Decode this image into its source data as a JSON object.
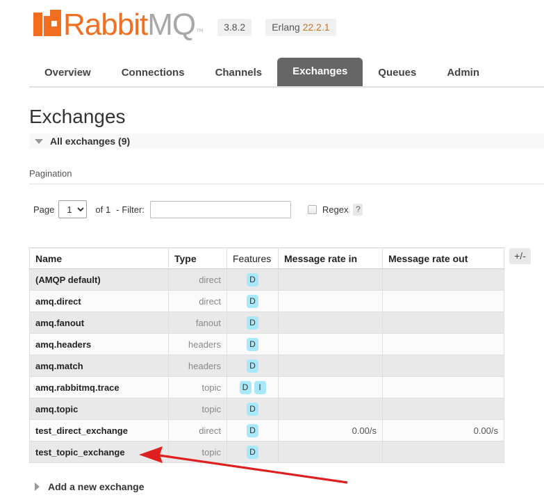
{
  "header": {
    "brand_rabbit": "Rabbit",
    "brand_mq": "MQ",
    "trademark": "™",
    "version": "3.8.2",
    "erlang_label": "Erlang",
    "erlang_version": "22.2.1",
    "brand_color": "#f26f21",
    "mq_color": "#a8a8a8"
  },
  "nav": {
    "tabs": [
      {
        "label": "Overview",
        "active": false
      },
      {
        "label": "Connections",
        "active": false
      },
      {
        "label": "Channels",
        "active": false
      },
      {
        "label": "Exchanges",
        "active": true
      },
      {
        "label": "Queues",
        "active": false
      },
      {
        "label": "Admin",
        "active": false
      }
    ],
    "active_tab_bg": "#666666"
  },
  "page": {
    "title": "Exchanges",
    "section_label": "All exchanges (9)",
    "section_expanded": true
  },
  "pagination": {
    "title": "Pagination",
    "page_label": "Page",
    "page_value": "1",
    "page_options": [
      "1"
    ],
    "of_label": "of 1",
    "dash": "-",
    "filter_label": "Filter:",
    "filter_value": "",
    "filter_placeholder": "",
    "regex_label": "Regex",
    "regex_checked": false,
    "help_label": "?"
  },
  "table": {
    "columns": [
      "Name",
      "Type",
      "Features",
      "Message rate in",
      "Message rate out"
    ],
    "column_toggle_label": "+/-",
    "rows": [
      {
        "name": "(AMQP default)",
        "type": "direct",
        "features": [
          "D"
        ],
        "rate_in": "",
        "rate_out": ""
      },
      {
        "name": "amq.direct",
        "type": "direct",
        "features": [
          "D"
        ],
        "rate_in": "",
        "rate_out": ""
      },
      {
        "name": "amq.fanout",
        "type": "fanout",
        "features": [
          "D"
        ],
        "rate_in": "",
        "rate_out": ""
      },
      {
        "name": "amq.headers",
        "type": "headers",
        "features": [
          "D"
        ],
        "rate_in": "",
        "rate_out": ""
      },
      {
        "name": "amq.match",
        "type": "headers",
        "features": [
          "D"
        ],
        "rate_in": "",
        "rate_out": ""
      },
      {
        "name": "amq.rabbitmq.trace",
        "type": "topic",
        "features": [
          "D",
          "I"
        ],
        "rate_in": "",
        "rate_out": ""
      },
      {
        "name": "amq.topic",
        "type": "topic",
        "features": [
          "D"
        ],
        "rate_in": "",
        "rate_out": ""
      },
      {
        "name": "test_direct_exchange",
        "type": "direct",
        "features": [
          "D"
        ],
        "rate_in": "0.00/s",
        "rate_out": "0.00/s"
      },
      {
        "name": "test_topic_exchange",
        "type": "topic",
        "features": [
          "D"
        ],
        "rate_in": "",
        "rate_out": ""
      }
    ],
    "feature_badge_color": "#a8e8fb"
  },
  "footer": {
    "add_exchange_label": "Add a new exchange",
    "add_expanded": false
  },
  "annotation": {
    "arrow_color": "#e02020",
    "points_to": "test_topic_exchange"
  }
}
